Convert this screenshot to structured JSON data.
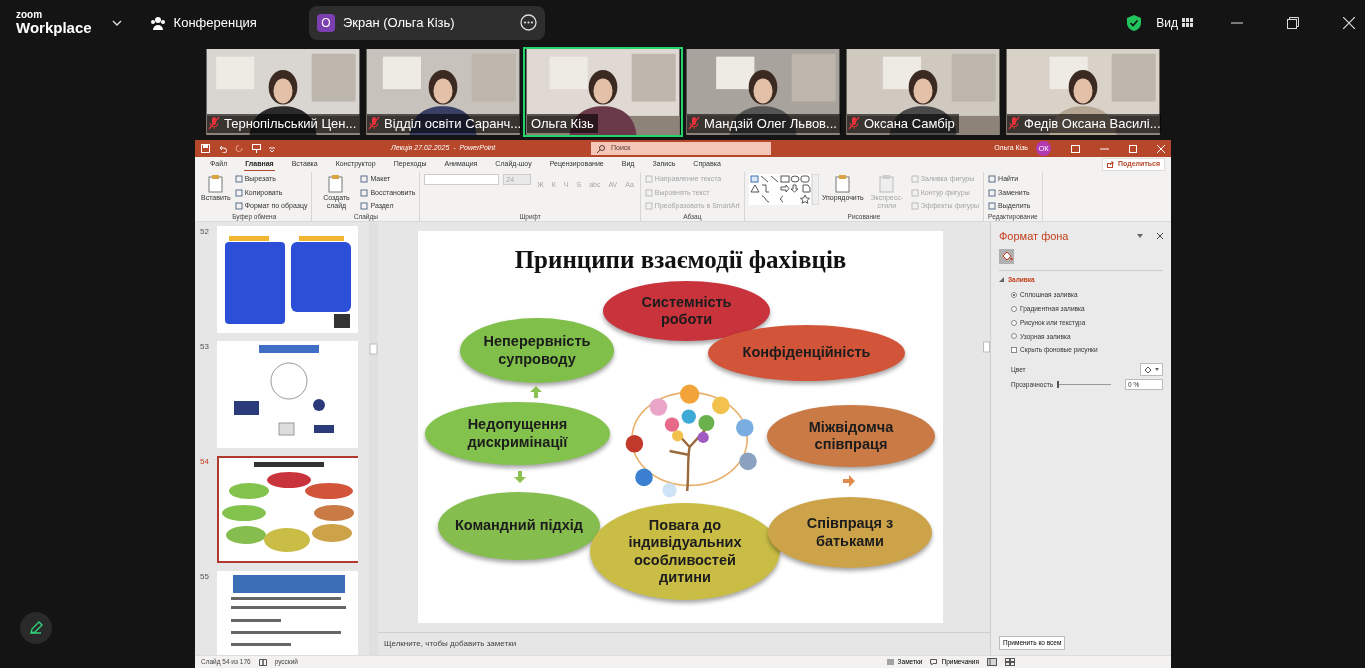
{
  "zoom": {
    "logo_top": "zoom",
    "logo_bottom": "Workplace",
    "meeting_title": "Конференция",
    "share_avatar": "О",
    "share_label": "Экран (Ольга Кізь)",
    "view_label": "Вид"
  },
  "participants": [
    {
      "name": "Тернопільський Цен...",
      "muted": true,
      "speaking": false
    },
    {
      "name": "Відділ освіти Саранч...",
      "muted": true,
      "speaking": false
    },
    {
      "name": "Ольга Кізь",
      "muted": false,
      "speaking": true
    },
    {
      "name": "Мандзій Олег Львов...",
      "muted": true,
      "speaking": false
    },
    {
      "name": "Оксана Самбір",
      "muted": true,
      "speaking": false
    },
    {
      "name": "Федів Оксана Василі...",
      "muted": true,
      "speaking": false
    }
  ],
  "powerpoint": {
    "title": "Лекція 27.02.2025  -  PowerPoint",
    "search_placeholder": "Поиск",
    "user_name": "Ольга Кізь",
    "user_initials": "ОК",
    "share_button": "Поделиться",
    "tabs": [
      {
        "label": "Файл",
        "selected": false
      },
      {
        "label": "Главная",
        "selected": true
      },
      {
        "label": "Вставка",
        "selected": false
      },
      {
        "label": "Конструктор",
        "selected": false
      },
      {
        "label": "Переходы",
        "selected": false
      },
      {
        "label": "Анимация",
        "selected": false
      },
      {
        "label": "Слайд-шоу",
        "selected": false
      },
      {
        "label": "Рецензирование",
        "selected": false
      },
      {
        "label": "Вид",
        "selected": false
      },
      {
        "label": "Запись",
        "selected": false
      },
      {
        "label": "Справка",
        "selected": false
      }
    ],
    "ribbon_groups": [
      {
        "label": "Буфер обмена",
        "items": [
          {
            "kind": "large",
            "label": "Вставить",
            "disabled": false
          },
          {
            "kind": "small",
            "label": "Вырезать",
            "disabled": false
          },
          {
            "kind": "small",
            "label": "Копировать",
            "disabled": false
          },
          {
            "kind": "small",
            "label": "Формат по образцу",
            "disabled": false
          }
        ]
      },
      {
        "label": "Слайды",
        "items": [
          {
            "kind": "large",
            "label": "Создать слайд",
            "disabled": false
          },
          {
            "kind": "small",
            "label": "Макет",
            "disabled": false
          },
          {
            "kind": "small",
            "label": "Восстановить",
            "disabled": false
          },
          {
            "kind": "small",
            "label": "Раздел",
            "disabled": false
          }
        ]
      },
      {
        "label": "Шрифт",
        "items": [
          {
            "kind": "font_row",
            "value": "24",
            "disabled": true
          },
          {
            "kind": "glyphs",
            "glyphs": [
              "Ж",
              "К",
              "Ч",
              "S",
              "abc",
              "AV",
              "Aa"
            ],
            "disabled": true
          }
        ]
      },
      {
        "label": "Абзац",
        "items": [
          {
            "kind": "small",
            "label": "Направление текста",
            "disabled": true
          },
          {
            "kind": "small",
            "label": "Выровнять текст",
            "disabled": true
          },
          {
            "kind": "small",
            "label": "Преобразовать в SmartArt",
            "disabled": true
          }
        ]
      },
      {
        "label": "Рисование",
        "items": [
          {
            "kind": "gallery",
            "disabled": false
          },
          {
            "kind": "large",
            "label": "Упорядочить",
            "disabled": false
          },
          {
            "kind": "large",
            "label": "Экспресс-стили",
            "disabled": true
          },
          {
            "kind": "small",
            "label": "Заливка фигуры",
            "disabled": true
          },
          {
            "kind": "small",
            "label": "Контур фигуры",
            "disabled": true
          },
          {
            "kind": "small",
            "label": "Эффекты фигуры",
            "disabled": true
          }
        ]
      },
      {
        "label": "Редактирование",
        "items": [
          {
            "kind": "small",
            "label": "Найти",
            "disabled": false
          },
          {
            "kind": "small",
            "label": "Заменить",
            "disabled": false
          },
          {
            "kind": "small",
            "label": "Выделить",
            "disabled": false
          }
        ]
      }
    ],
    "thumbnails": [
      {
        "number": "52",
        "selected": false
      },
      {
        "number": "53",
        "selected": false
      },
      {
        "number": "54",
        "selected": true
      },
      {
        "number": "55",
        "selected": false
      }
    ],
    "slide": {
      "title": "Принципи взаємодії фахівців",
      "principles": [
        {
          "text": "Системність роботи",
          "color": "#c8333c"
        },
        {
          "text": "Неперервність супроводу",
          "color": "#7fbf4a"
        },
        {
          "text": "Конфіденційність",
          "color": "#d2553a"
        },
        {
          "text": "Недопущення дискримінації",
          "color": "#84c24e"
        },
        {
          "text": "Міжвідомча співпраця",
          "color": "#c97a45"
        },
        {
          "text": "Командний підхід",
          "color": "#86bd4f"
        },
        {
          "text": "Повага до індивідуальних особливостей дитини",
          "color": "#c9bd45"
        },
        {
          "text": "Співпраця з батьками",
          "color": "#cda349"
        }
      ]
    },
    "notes_placeholder": "Щелкните, чтобы добавить заметки",
    "format_pane": {
      "title": "Формат фона",
      "section": {
        "label": "Заливка",
        "expanded": true
      },
      "fill_options": [
        {
          "label": "Сплошная заливка",
          "selected": true
        },
        {
          "label": "Градиентная заливка",
          "selected": false
        },
        {
          "label": "Рисунок или текстура",
          "selected": false
        },
        {
          "label": "Узорная заливка",
          "selected": false
        }
      ],
      "hide_background": {
        "label": "Скрыть фоновые рисунки",
        "checked": false
      },
      "color_label": "Цвет",
      "transparency_label": "Прозрачность",
      "transparency": {
        "level": 0
      },
      "transparency_value": "0 %",
      "apply_button": "Применить ко всем"
    },
    "status_bar": {
      "slide_info": "Слайд 54 из 176",
      "language": "русский",
      "notes": "Заметки",
      "comments": "Примечания"
    }
  }
}
